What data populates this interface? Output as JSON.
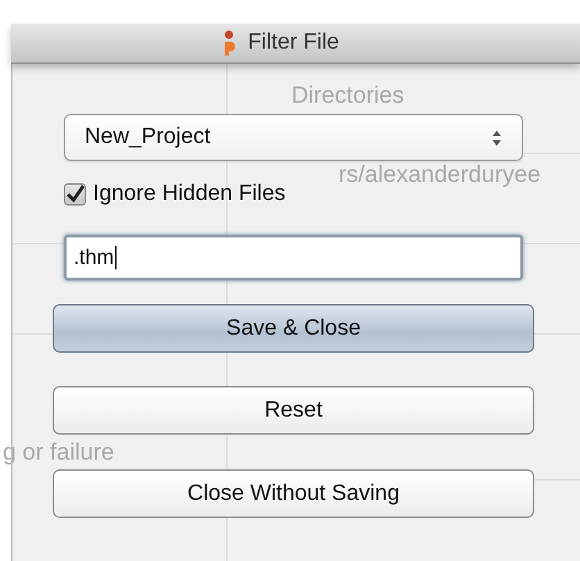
{
  "background_window": {
    "texts": [
      "Directories",
      "rs/alexanderduryee",
      "g or failure"
    ]
  },
  "dialog": {
    "title": "Filter File",
    "project_select": {
      "value": "New_Project"
    },
    "ignore_hidden": {
      "label": "Ignore Hidden Files",
      "checked": true
    },
    "filter_field": {
      "value": ".thm"
    },
    "buttons": [
      {
        "label": "Save & Close",
        "default": true
      },
      {
        "label": "Reset",
        "default": false
      },
      {
        "label": "Close Without Saving",
        "default": false
      }
    ]
  }
}
